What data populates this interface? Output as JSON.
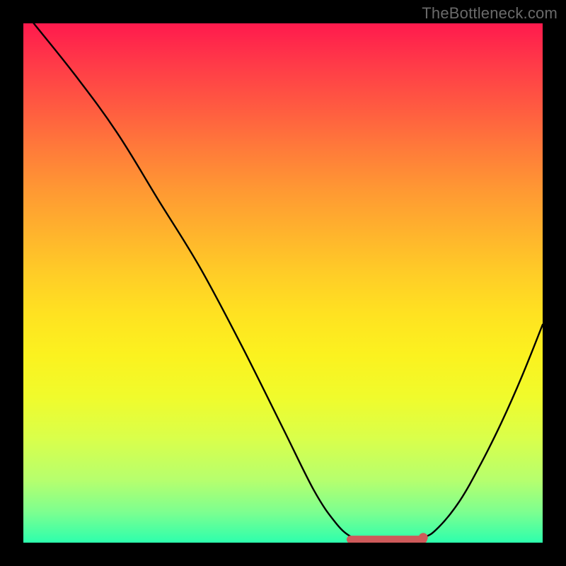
{
  "watermark": "TheBottleneck.com",
  "chart_data": {
    "type": "line",
    "title": "",
    "xlabel": "",
    "ylabel": "",
    "x_range": [
      0,
      1
    ],
    "y_range": [
      0,
      1
    ],
    "series": [
      {
        "name": "curve",
        "points": [
          {
            "x": 0.02,
            "y": 1.0
          },
          {
            "x": 0.1,
            "y": 0.9
          },
          {
            "x": 0.18,
            "y": 0.79
          },
          {
            "x": 0.26,
            "y": 0.66
          },
          {
            "x": 0.34,
            "y": 0.53
          },
          {
            "x": 0.42,
            "y": 0.38
          },
          {
            "x": 0.5,
            "y": 0.22
          },
          {
            "x": 0.56,
            "y": 0.1
          },
          {
            "x": 0.6,
            "y": 0.04
          },
          {
            "x": 0.63,
            "y": 0.012
          },
          {
            "x": 0.66,
            "y": 0.004
          },
          {
            "x": 0.72,
            "y": 0.003
          },
          {
            "x": 0.77,
            "y": 0.01
          },
          {
            "x": 0.8,
            "y": 0.03
          },
          {
            "x": 0.84,
            "y": 0.08
          },
          {
            "x": 0.88,
            "y": 0.15
          },
          {
            "x": 0.92,
            "y": 0.23
          },
          {
            "x": 0.96,
            "y": 0.32
          },
          {
            "x": 1.0,
            "y": 0.42
          }
        ]
      }
    ],
    "annotations": {
      "flat_region": {
        "x_start": 0.63,
        "x_end": 0.77,
        "y": 0.006
      },
      "flat_region_end_dot": {
        "x": 0.77,
        "y": 0.01
      }
    },
    "background": {
      "type": "vertical-gradient",
      "stops": [
        {
          "pos": 0.0,
          "color": "#ff1a4d"
        },
        {
          "pos": 0.5,
          "color": "#ffd824"
        },
        {
          "pos": 1.0,
          "color": "#2dffad"
        }
      ]
    }
  }
}
